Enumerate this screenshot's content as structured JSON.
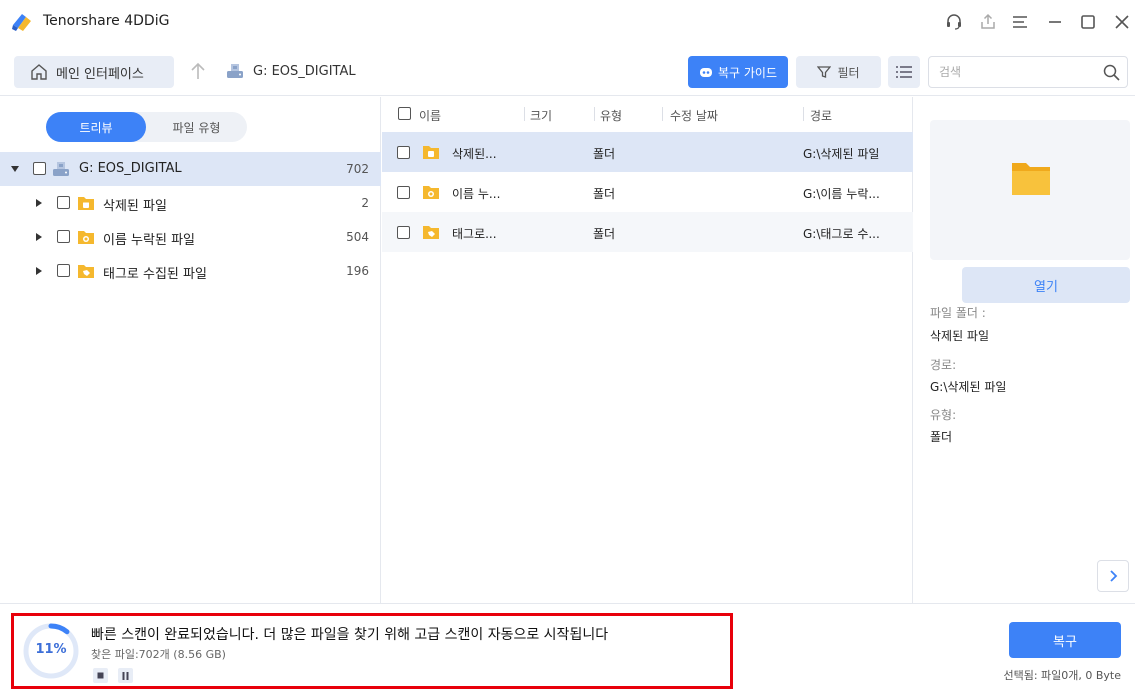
{
  "app": {
    "title": "Tenorshare 4DDiG"
  },
  "toolbar": {
    "home_label": "메인 인터페이스",
    "path_label": "G: EOS_DIGITAL",
    "guide_label": "복구 가이드",
    "filter_label": "필터",
    "search_placeholder": "검색"
  },
  "tree": {
    "view_tabs": [
      "트리뷰",
      "파일 유형"
    ],
    "active_tab": "트리뷰",
    "root": {
      "label": "G: EOS_DIGITAL",
      "count": "702"
    },
    "children": [
      {
        "label": "삭제된 파일",
        "count": "2"
      },
      {
        "label": "이름 누락된 파일",
        "count": "504"
      },
      {
        "label": "태그로 수집된 파일",
        "count": "196"
      }
    ]
  },
  "list": {
    "columns": [
      "이름",
      "크기",
      "유형",
      "수정 날짜",
      "경로"
    ],
    "rows": [
      {
        "name": "삭제된...",
        "size": "",
        "type": "폴더",
        "date": "",
        "path": "G:\\삭제된 파일"
      },
      {
        "name": "이름 누...",
        "size": "",
        "type": "폴더",
        "date": "",
        "path": "G:\\이름 누락..."
      },
      {
        "name": "태그로...",
        "size": "",
        "type": "폴더",
        "date": "",
        "path": "G:\\태그로 수..."
      }
    ]
  },
  "preview": {
    "open_label": "열기",
    "folder_label": "파일 폴더 :",
    "folder_value": "삭제된 파일",
    "path_label": "경로:",
    "path_value": "G:\\삭제된 파일",
    "type_label": "유형:",
    "type_value": "폴더"
  },
  "scan": {
    "progress": 11,
    "progress_label": "11%",
    "title": "빠른 스캔이 완료되었습니다. 더 많은 파일을 찾기 위해 고급 스캔이 자동으로 시작됩니다",
    "subtitle": "찾은 파일:702개 (8.56 GB)"
  },
  "footer": {
    "recover_label": "복구",
    "selection_info": "선택됨: 파일0개, 0 Byte"
  },
  "colors": {
    "accent": "#3d82f7",
    "selection": "#dde6f6",
    "highlight_border": "#e8000a",
    "folder": "#f5b82e"
  }
}
